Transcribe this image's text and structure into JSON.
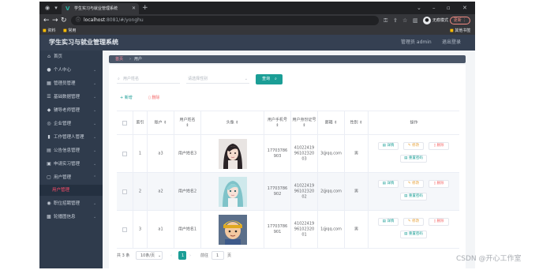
{
  "browser": {
    "tab_title": "学生实习与就业管理系统",
    "url_host": "localhost",
    "url_path": ":8081/#/yonghu",
    "bookmarks": [
      "资料",
      "常用"
    ],
    "other_bookmarks": "其他书签",
    "incognito_label": "无痕模式",
    "update_label": "更新"
  },
  "header": {
    "title": "学生实习与就业管理系统",
    "admin_label": "管理员 admin",
    "logout_label": "退出登录"
  },
  "sidebar": {
    "items": [
      {
        "label": "首页",
        "icon": "home-icon",
        "has_children": false
      },
      {
        "label": "个人中心",
        "icon": "user-icon",
        "has_children": true
      },
      {
        "label": "管理员管理",
        "icon": "admin-icon",
        "has_children": true
      },
      {
        "label": "基础数据管理",
        "icon": "database-icon",
        "has_children": true
      },
      {
        "label": "辅导老师管理",
        "icon": "teacher-icon",
        "has_children": true
      },
      {
        "label": "企业管理",
        "icon": "company-icon",
        "has_children": true
      },
      {
        "label": "工作管理人管理",
        "icon": "chart-icon",
        "has_children": true
      },
      {
        "label": "公告信息管理",
        "icon": "notice-icon",
        "has_children": true
      },
      {
        "label": "申请实习管理",
        "icon": "apply-icon",
        "has_children": true
      },
      {
        "label": "用户管理",
        "icon": "users-icon",
        "has_children": true
      }
    ],
    "active_sub": "用户管理",
    "after_items": [
      {
        "label": "职位招聘管理",
        "icon": "recruit-icon",
        "has_children": true
      },
      {
        "label": "轮播图信息",
        "icon": "carousel-icon",
        "has_children": true
      }
    ]
  },
  "breadcrumb": {
    "home": "首页",
    "separator": "›",
    "current": "用户"
  },
  "search": {
    "name_placeholder": "用户姓名",
    "gender_placeholder": "请选择性别",
    "query_label": "查询"
  },
  "actions": {
    "add_label": "新增",
    "delete_label": "删除"
  },
  "table": {
    "headers": [
      "索引",
      "账户",
      "用户姓名",
      "头像",
      "用户手机号",
      "用户身份证号",
      "邮箱",
      "性别",
      "操作"
    ],
    "rows": [
      {
        "index": "1",
        "account": "a3",
        "name": "用户姓名3",
        "phone": "17703786903",
        "idcard": "410224199610232003",
        "email": "3@qq.com",
        "gender": "男",
        "avatar": "avatar-girl-dark-hair"
      },
      {
        "index": "2",
        "account": "a2",
        "name": "用户姓名2",
        "phone": "17703786902",
        "idcard": "410224199610232002",
        "email": "2@qq.com",
        "gender": "男",
        "avatar": "avatar-girl-teal-hair"
      },
      {
        "index": "3",
        "account": "a1",
        "name": "用户姓名1",
        "phone": "17703786901",
        "idcard": "410224199610232001",
        "email": "1@qq.com",
        "gender": "男",
        "avatar": "avatar-boy-yellow-cap"
      }
    ],
    "ops": {
      "detail": "详情",
      "edit": "修改",
      "delete": "删除",
      "reset": "重置密码"
    }
  },
  "pager": {
    "total": "共 3 条",
    "page_size": "10条/页",
    "current_page": "1",
    "goto_label": "前往",
    "goto_value": "1",
    "page_unit": "页"
  },
  "colors": {
    "topbar": "#354052",
    "sidebar": "#2f3b4c",
    "accent": "#1b9e96",
    "active_sub": "#ff4d6a"
  },
  "watermark": "CSDN @开心工作室"
}
